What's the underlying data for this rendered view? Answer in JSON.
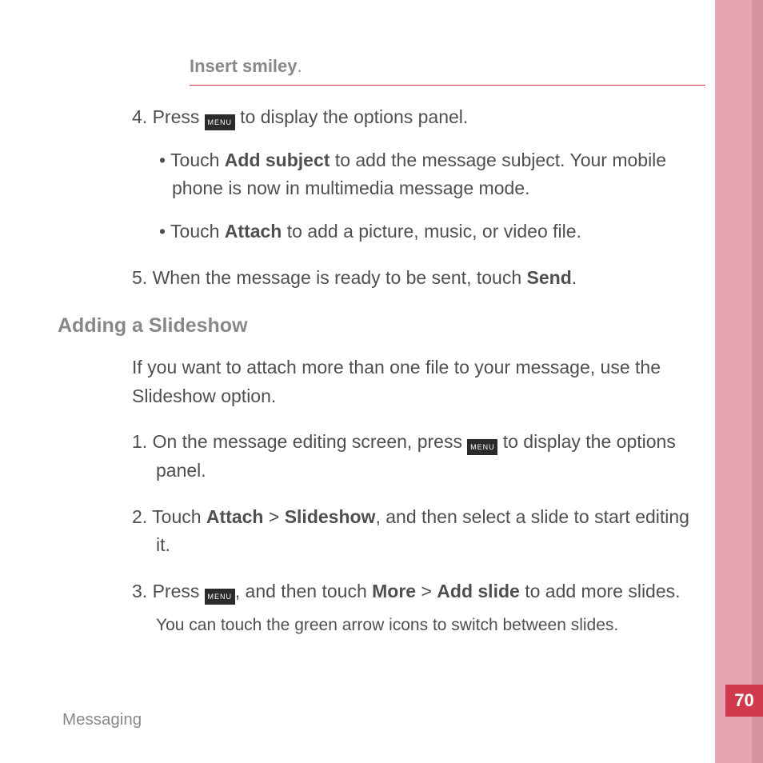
{
  "header": {
    "title_bold": "Insert smiley",
    "title_tail": "."
  },
  "icons": {
    "menu": "MENU"
  },
  "list1": {
    "item4": {
      "num": "4. ",
      "p1a": "Press ",
      "p1b": " to display the options panel.",
      "sub1": {
        "bullet": "• ",
        "a": "Touch ",
        "b": "Add subject",
        "c": " to add the message subject. Your mobile phone is now in multimedia message mode."
      },
      "sub2": {
        "bullet": "• ",
        "a": "Touch ",
        "b": "Attach",
        "c": " to add a picture, music, or video file."
      }
    },
    "item5": {
      "num": "5. ",
      "a": "When the message is ready to be sent, touch ",
      "b": "Send",
      "c": "."
    }
  },
  "section2": {
    "heading": "Adding a Slideshow",
    "intro": "If you want to attach more than one file to your message, use the Slideshow option.",
    "s1": {
      "num": "1. ",
      "a": "On the message editing screen, press ",
      "b": " to display the options panel."
    },
    "s2": {
      "num": "2. ",
      "a": "Touch ",
      "b": "Attach",
      "gt1": " > ",
      "c": "Slideshow",
      "d": ", and then select a slide to start editing it."
    },
    "s3": {
      "num": "3. ",
      "a": "Press ",
      "b": ", and then touch ",
      "c": "More",
      "gt2": " > ",
      "d": "Add slide",
      "e": " to add more slides."
    },
    "note": "You can touch the green arrow icons to switch between slides."
  },
  "footer": "Messaging",
  "page_number": "70"
}
